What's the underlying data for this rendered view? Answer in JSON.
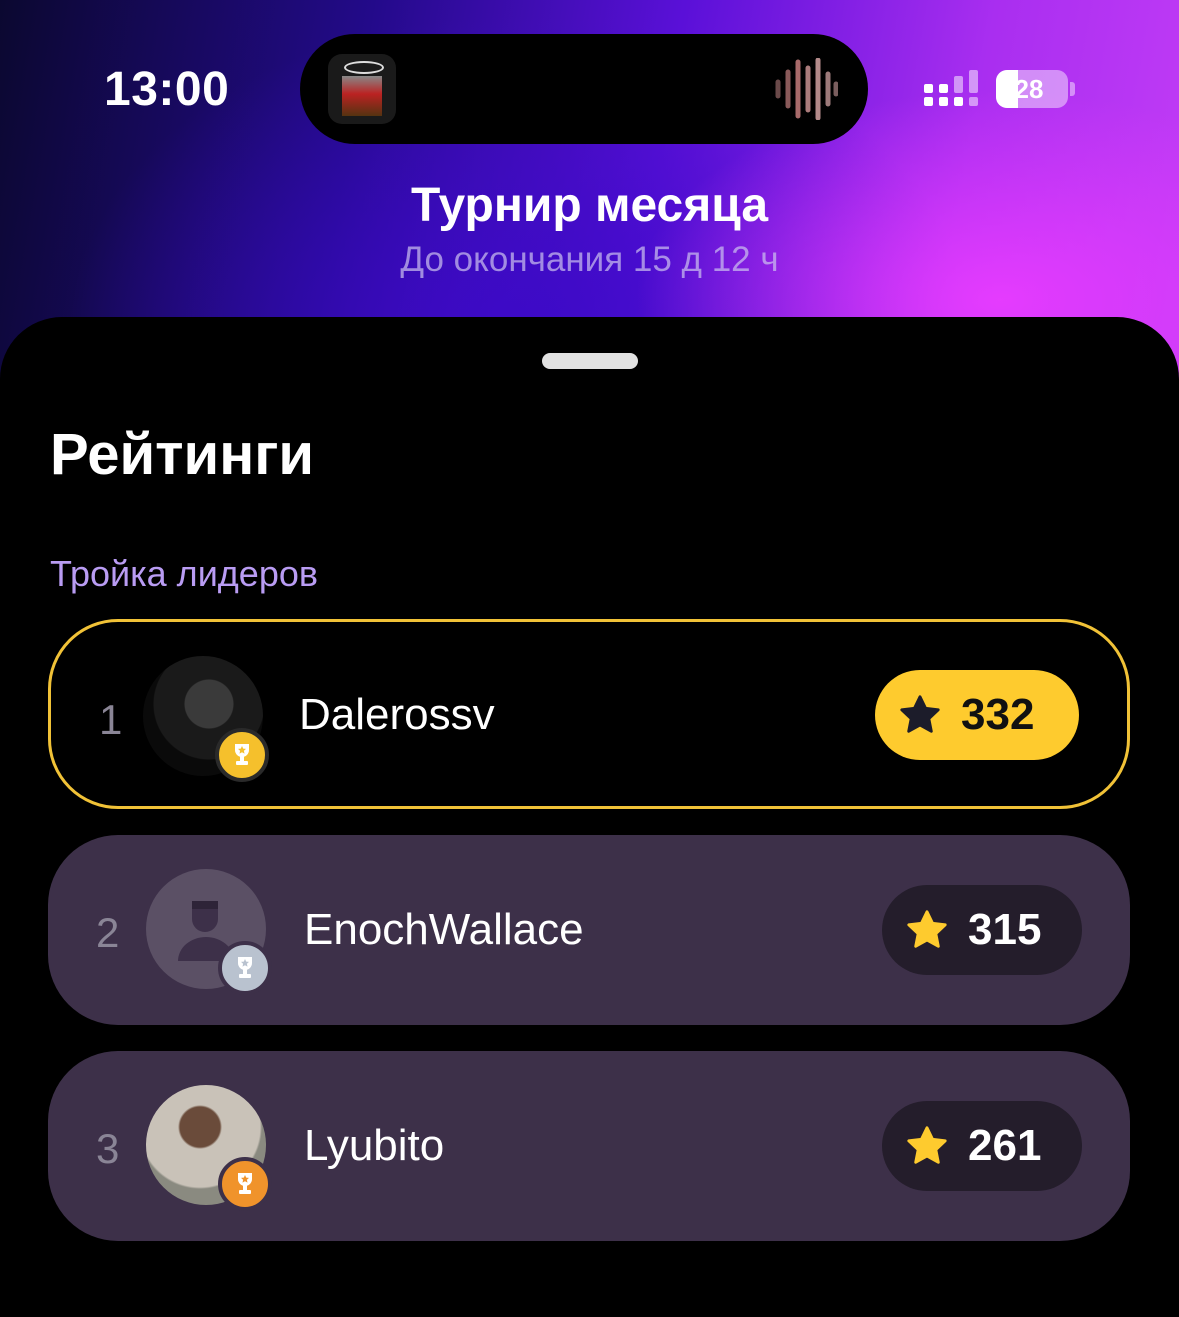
{
  "status_bar": {
    "time": "13:00",
    "battery": "28"
  },
  "header": {
    "title": "Турнир месяца",
    "subtitle": "До окончания 15 д 12 ч"
  },
  "sheet": {
    "section_title": "Рейтинги",
    "leaders_label": "Тройка лидеров",
    "leaders": [
      {
        "rank": "1",
        "name": "Dalerossv",
        "score": "332",
        "medal": "gold"
      },
      {
        "rank": "2",
        "name": "EnochWallace",
        "score": "315",
        "medal": "silver"
      },
      {
        "rank": "3",
        "name": "Lyubito",
        "score": "261",
        "medal": "bronze"
      }
    ]
  },
  "colors": {
    "accent_gold": "#fecb2e",
    "leader_border": "#f1c237",
    "row_bg": "#3d3049",
    "label_purple": "#b99cf3"
  },
  "icons": [
    "star-icon",
    "trophy-icon",
    "signal-icon",
    "battery-icon",
    "waveform-icon"
  ]
}
